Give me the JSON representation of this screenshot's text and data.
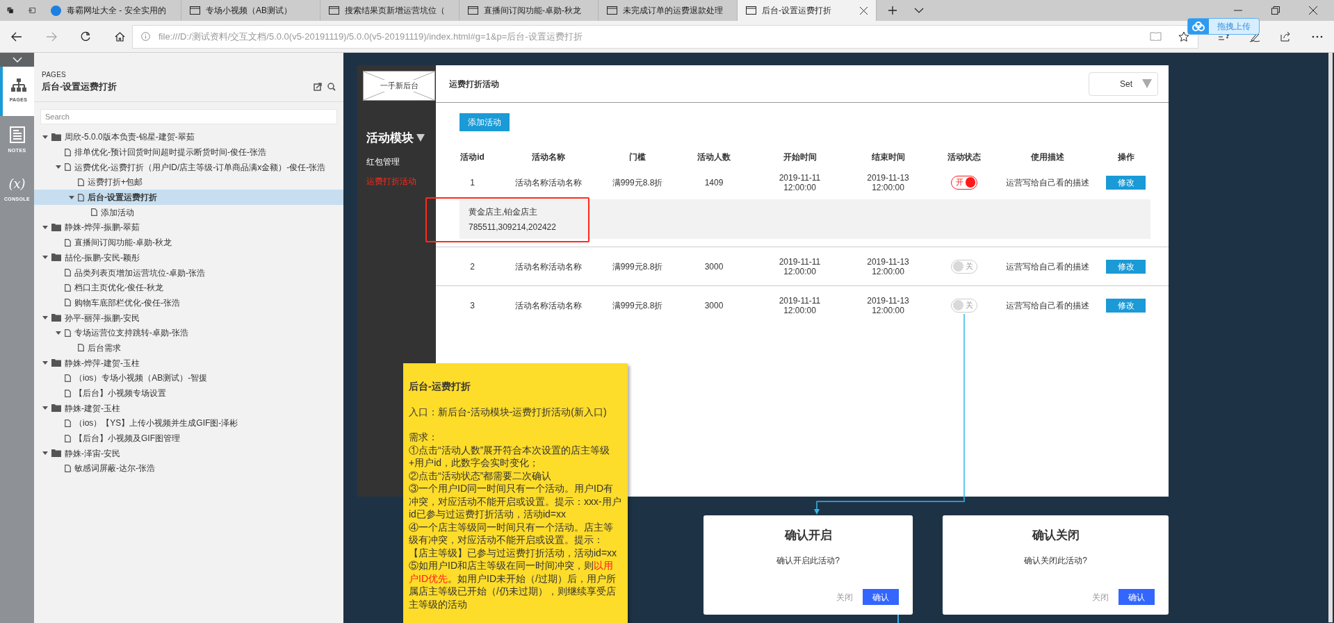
{
  "browser": {
    "tabs": [
      {
        "title": "毒霸网址大全 - 安全实用的",
        "kind": "site",
        "selected": false
      },
      {
        "title": "专场小视频（AB测试）",
        "kind": "page",
        "selected": false
      },
      {
        "title": "搜索结果页新增运营坑位（",
        "kind": "page",
        "selected": false
      },
      {
        "title": "直播间订阅功能-卓勋-秋龙",
        "kind": "page",
        "selected": false
      },
      {
        "title": "未完成订单的运费退款处理",
        "kind": "page",
        "selected": false
      },
      {
        "title": "后台-设置运费打折",
        "kind": "page",
        "selected": true
      }
    ],
    "address": "file:///D:/测试资料/交互文档/5.0.0(v5-20191119)/5.0.0(v5-20191119)/index.html#g=1&p=后台-设置运费打折",
    "upload_badge": "拖拽上传"
  },
  "rail": [
    {
      "label": "PAGES",
      "kind": "pages",
      "selected": true
    },
    {
      "label": "NOTES",
      "kind": "notes",
      "selected": false
    },
    {
      "label": "CONSOLE",
      "kind": "console",
      "glyph": "(x)",
      "selected": false
    }
  ],
  "pages_panel": {
    "heading": "PAGES",
    "title": "后台-设置运费打折",
    "search_placeholder": "Search",
    "tree": [
      {
        "label": "周欣-5.0.0版本负责-锦星-建贺-翠茹",
        "kind": "folder",
        "expanded": true,
        "selected": false,
        "children": [
          {
            "label": "排单优化-预计回货时间超时提示断货时间-俊任-张浩",
            "kind": "page",
            "selected": false
          },
          {
            "label": "运费优化-运费打折（用户ID/店主等级-订单商品满x金额）-俊任-张浩",
            "kind": "page",
            "expanded": true,
            "selected": false,
            "children": [
              {
                "label": "运费打折+包邮",
                "kind": "page",
                "selected": false
              },
              {
                "label": "后台-设置运费打折",
                "kind": "page",
                "expanded": true,
                "selected": true,
                "children": [
                  {
                    "label": "添加活动",
                    "kind": "page",
                    "selected": false
                  }
                ]
              }
            ]
          }
        ]
      },
      {
        "label": "静姝-烨萍-振鹏-翠茹",
        "kind": "folder",
        "expanded": true,
        "selected": false,
        "children": [
          {
            "label": "直播间订阅功能-卓勋-秋龙",
            "kind": "page",
            "selected": false
          }
        ]
      },
      {
        "label": "喆伦-振鹏-安民-颖彤",
        "kind": "folder",
        "expanded": true,
        "selected": false,
        "children": [
          {
            "label": "品类列表页增加运营坑位-卓勋-张浩",
            "kind": "page",
            "selected": false
          },
          {
            "label": "档口主页优化-俊任-秋龙",
            "kind": "page",
            "selected": false
          },
          {
            "label": "购物车底部栏优化-俊任-张浩",
            "kind": "page",
            "selected": false
          }
        ]
      },
      {
        "label": "孙平-丽萍-振鹏-安民",
        "kind": "folder",
        "expanded": true,
        "selected": false,
        "children": [
          {
            "label": "专场运营位支持跳转-卓勋-张浩",
            "kind": "page",
            "expanded": true,
            "selected": false,
            "children": [
              {
                "label": "后台需求",
                "kind": "page",
                "selected": false
              }
            ]
          }
        ]
      },
      {
        "label": "静姝-烨萍-建贺-玉柱",
        "kind": "folder",
        "expanded": true,
        "selected": false,
        "children": [
          {
            "label": "（ios）专场小视频（AB测试）-智援",
            "kind": "page",
            "selected": false
          },
          {
            "label": "【后台】小视频专场设置",
            "kind": "page",
            "selected": false
          }
        ]
      },
      {
        "label": "静姝-建贺-玉柱",
        "kind": "folder",
        "expanded": true,
        "selected": false,
        "children": [
          {
            "label": "（ios）【YS】上传小视频并生成GIF图-泽彬",
            "kind": "page",
            "selected": false
          },
          {
            "label": "【后台】小视频及GIF图管理",
            "kind": "page",
            "selected": false
          }
        ]
      },
      {
        "label": "静姝-泽宙-安民",
        "kind": "folder",
        "expanded": true,
        "selected": false,
        "children": [
          {
            "label": "敏感词屏蔽-达尔-张浩",
            "kind": "page",
            "selected": false
          }
        ]
      }
    ]
  },
  "prototype": {
    "logo": "一手新后台",
    "page_title": "运费打折活动",
    "set_dropdown": "Set",
    "nav_heading": "活动模块",
    "nav_items": [
      {
        "label": "红包管理",
        "selected": false
      },
      {
        "label": "运费打折活动",
        "selected": true
      }
    ],
    "add_button": "添加活动",
    "table": {
      "columns": [
        "活动id",
        "活动名称",
        "门槛",
        "活动人数",
        "开始时间",
        "结束时间",
        "活动状态",
        "使用描述",
        "操作"
      ],
      "rows": [
        {
          "id": "1",
          "name": "活动名称活动名称",
          "threshold": "满999元8.8折",
          "count": "1409",
          "start": [
            "2019-11-11",
            "12:00:00"
          ],
          "end": [
            "2019-11-13",
            "12:00:00"
          ],
          "status_label": "开",
          "on": true,
          "description": "运营写给自己看的描述",
          "action": "修改",
          "expanded": true,
          "detail": [
            "黄金店主,铂金店主",
            "785511,309214,202422"
          ]
        },
        {
          "id": "2",
          "name": "活动名称活动名称",
          "threshold": "满999元8.8折",
          "count": "3000",
          "start": [
            "2019-11-11",
            "12:00:00"
          ],
          "end": [
            "2019-11-13",
            "12:00:00"
          ],
          "status_label": "关",
          "on": false,
          "description": "运营写给自己看的描述",
          "action": "修改",
          "expanded": false
        },
        {
          "id": "3",
          "name": "活动名称活动名称",
          "threshold": "满999元8.8折",
          "count": "3000",
          "start": [
            "2019-11-11",
            "12:00:00"
          ],
          "end": [
            "2019-11-13",
            "12:00:00"
          ],
          "status_label": "关",
          "on": false,
          "description": "运营写给自己看的描述",
          "action": "修改",
          "expanded": false
        }
      ]
    }
  },
  "note": {
    "title": "后台-运费打折",
    "entry": "入口：新后台-活动模块-运费打折活动(新入口)",
    "requirements_label": "需求：",
    "requirements": [
      [
        {
          "text": "①点击“活动人数”展开符合本次设置的店主等级+用户id，此数字会实时变化；",
          "emphasis": false
        }
      ],
      [
        {
          "text": "②点击“活动状态”都需要二次确认",
          "emphasis": false
        }
      ],
      [
        {
          "text": "③一个用户ID同一时间只有一个活动。用户ID有冲突，对应活动不能开启或设置。提示：xxx-用户id已参与过运费打折活动，活动id=xx",
          "emphasis": false
        }
      ],
      [
        {
          "text": "④一个店主等级同一时间只有一个活动。店主等级有冲突，对应活动不能开启或设置。提示：【店主等级】已参与过运费打折活动，活动id=xx",
          "emphasis": false
        }
      ],
      [
        {
          "text": "⑤如用户ID和店主等级在同一时间冲突，则",
          "emphasis": false
        },
        {
          "text": "以用户ID优先",
          "emphasis": true
        },
        {
          "text": "。如用户ID未开始（/过期）后，用户所属店主等级已开始（/仍未过期），则继续享受店主等级的活动",
          "emphasis": false
        }
      ]
    ]
  },
  "dialogs": [
    {
      "title": "确认开启",
      "message": "确认开启此活动?",
      "cancel": "关闭",
      "confirm": "确认"
    },
    {
      "title": "确认关闭",
      "message": "确认关闭此活动?",
      "cancel": "关闭",
      "confirm": "确认"
    }
  ]
}
